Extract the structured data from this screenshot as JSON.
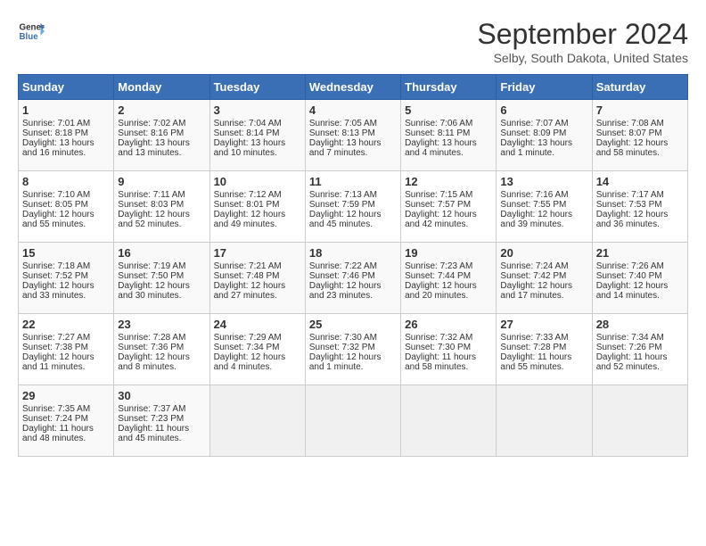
{
  "header": {
    "logo_line1": "General",
    "logo_line2": "Blue",
    "title": "September 2024",
    "location": "Selby, South Dakota, United States"
  },
  "days_of_week": [
    "Sunday",
    "Monday",
    "Tuesday",
    "Wednesday",
    "Thursday",
    "Friday",
    "Saturday"
  ],
  "weeks": [
    [
      {
        "num": "1",
        "sunrise": "7:01 AM",
        "sunset": "8:18 PM",
        "daylight": "13 hours and 16 minutes."
      },
      {
        "num": "2",
        "sunrise": "7:02 AM",
        "sunset": "8:16 PM",
        "daylight": "13 hours and 13 minutes."
      },
      {
        "num": "3",
        "sunrise": "7:04 AM",
        "sunset": "8:14 PM",
        "daylight": "13 hours and 10 minutes."
      },
      {
        "num": "4",
        "sunrise": "7:05 AM",
        "sunset": "8:13 PM",
        "daylight": "13 hours and 7 minutes."
      },
      {
        "num": "5",
        "sunrise": "7:06 AM",
        "sunset": "8:11 PM",
        "daylight": "13 hours and 4 minutes."
      },
      {
        "num": "6",
        "sunrise": "7:07 AM",
        "sunset": "8:09 PM",
        "daylight": "13 hours and 1 minute."
      },
      {
        "num": "7",
        "sunrise": "7:08 AM",
        "sunset": "8:07 PM",
        "daylight": "12 hours and 58 minutes."
      }
    ],
    [
      {
        "num": "8",
        "sunrise": "7:10 AM",
        "sunset": "8:05 PM",
        "daylight": "12 hours and 55 minutes."
      },
      {
        "num": "9",
        "sunrise": "7:11 AM",
        "sunset": "8:03 PM",
        "daylight": "12 hours and 52 minutes."
      },
      {
        "num": "10",
        "sunrise": "7:12 AM",
        "sunset": "8:01 PM",
        "daylight": "12 hours and 49 minutes."
      },
      {
        "num": "11",
        "sunrise": "7:13 AM",
        "sunset": "7:59 PM",
        "daylight": "12 hours and 45 minutes."
      },
      {
        "num": "12",
        "sunrise": "7:15 AM",
        "sunset": "7:57 PM",
        "daylight": "12 hours and 42 minutes."
      },
      {
        "num": "13",
        "sunrise": "7:16 AM",
        "sunset": "7:55 PM",
        "daylight": "12 hours and 39 minutes."
      },
      {
        "num": "14",
        "sunrise": "7:17 AM",
        "sunset": "7:53 PM",
        "daylight": "12 hours and 36 minutes."
      }
    ],
    [
      {
        "num": "15",
        "sunrise": "7:18 AM",
        "sunset": "7:52 PM",
        "daylight": "12 hours and 33 minutes."
      },
      {
        "num": "16",
        "sunrise": "7:19 AM",
        "sunset": "7:50 PM",
        "daylight": "12 hours and 30 minutes."
      },
      {
        "num": "17",
        "sunrise": "7:21 AM",
        "sunset": "7:48 PM",
        "daylight": "12 hours and 27 minutes."
      },
      {
        "num": "18",
        "sunrise": "7:22 AM",
        "sunset": "7:46 PM",
        "daylight": "12 hours and 23 minutes."
      },
      {
        "num": "19",
        "sunrise": "7:23 AM",
        "sunset": "7:44 PM",
        "daylight": "12 hours and 20 minutes."
      },
      {
        "num": "20",
        "sunrise": "7:24 AM",
        "sunset": "7:42 PM",
        "daylight": "12 hours and 17 minutes."
      },
      {
        "num": "21",
        "sunrise": "7:26 AM",
        "sunset": "7:40 PM",
        "daylight": "12 hours and 14 minutes."
      }
    ],
    [
      {
        "num": "22",
        "sunrise": "7:27 AM",
        "sunset": "7:38 PM",
        "daylight": "12 hours and 11 minutes."
      },
      {
        "num": "23",
        "sunrise": "7:28 AM",
        "sunset": "7:36 PM",
        "daylight": "12 hours and 8 minutes."
      },
      {
        "num": "24",
        "sunrise": "7:29 AM",
        "sunset": "7:34 PM",
        "daylight": "12 hours and 4 minutes."
      },
      {
        "num": "25",
        "sunrise": "7:30 AM",
        "sunset": "7:32 PM",
        "daylight": "12 hours and 1 minute."
      },
      {
        "num": "26",
        "sunrise": "7:32 AM",
        "sunset": "7:30 PM",
        "daylight": "11 hours and 58 minutes."
      },
      {
        "num": "27",
        "sunrise": "7:33 AM",
        "sunset": "7:28 PM",
        "daylight": "11 hours and 55 minutes."
      },
      {
        "num": "28",
        "sunrise": "7:34 AM",
        "sunset": "7:26 PM",
        "daylight": "11 hours and 52 minutes."
      }
    ],
    [
      {
        "num": "29",
        "sunrise": "7:35 AM",
        "sunset": "7:24 PM",
        "daylight": "11 hours and 48 minutes."
      },
      {
        "num": "30",
        "sunrise": "7:37 AM",
        "sunset": "7:23 PM",
        "daylight": "11 hours and 45 minutes."
      },
      null,
      null,
      null,
      null,
      null
    ]
  ]
}
